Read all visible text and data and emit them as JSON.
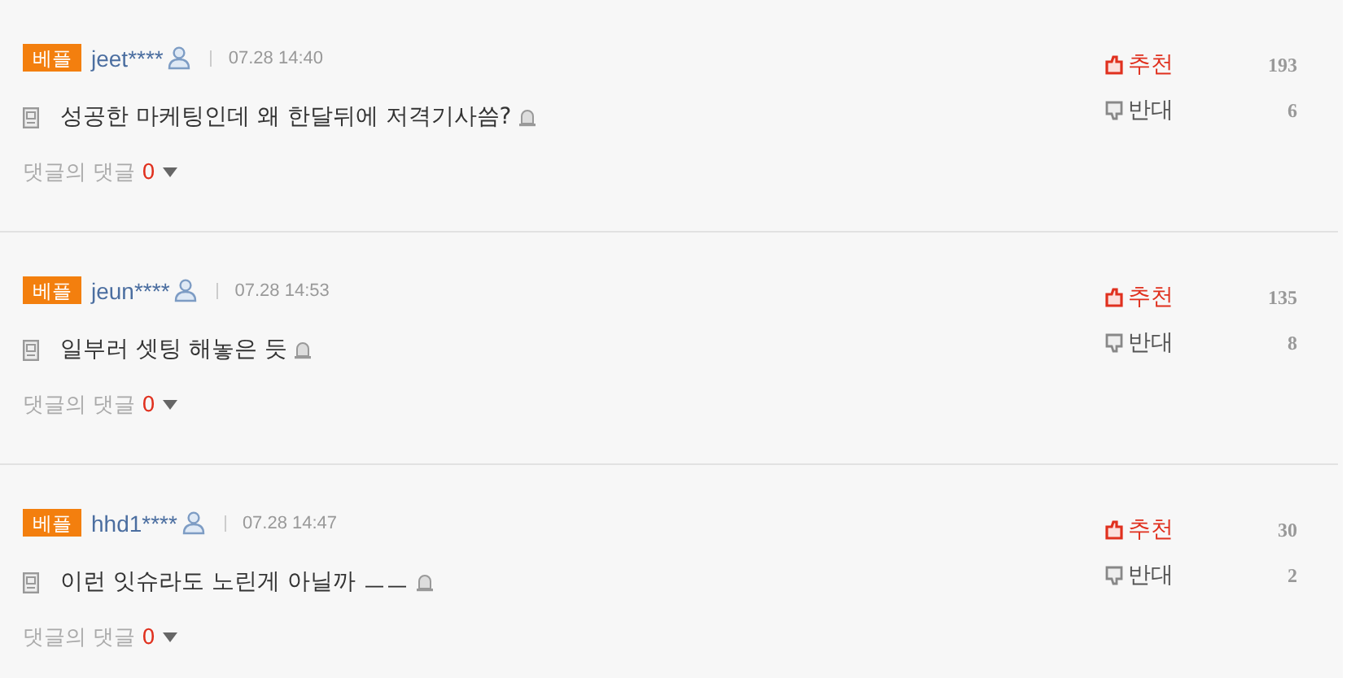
{
  "comments": [
    {
      "badge": "베플",
      "user": "jeet****",
      "time": "07.28 14:40",
      "text": "성공한 마케팅인데 왜 한달뒤에 저격기사씀?",
      "up_label": "추천",
      "up_count": "193",
      "down_label": "반대",
      "down_count": "6",
      "replies_label": "댓글의 댓글",
      "replies_count": "0"
    },
    {
      "badge": "베플",
      "user": "jeun****",
      "time": "07.28 14:53",
      "text": "일부러 셋팅 해놓은 듯",
      "up_label": "추천",
      "up_count": "135",
      "down_label": "반대",
      "down_count": "8",
      "replies_label": "댓글의 댓글",
      "replies_count": "0"
    },
    {
      "badge": "베플",
      "user": "hhd1****",
      "time": "07.28 14:47",
      "text": "이런 잇슈라도 노린게 아닐까 ㅡㅡ",
      "up_label": "추천",
      "up_count": "30",
      "down_label": "반대",
      "down_count": "2",
      "replies_label": "댓글의 댓글",
      "replies_count": "0"
    }
  ]
}
